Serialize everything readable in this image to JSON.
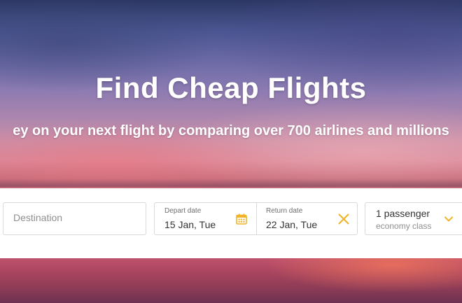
{
  "hero": {
    "title": "Find Cheap Flights",
    "subtitle": "ey on your next flight by comparing over 700 airlines and millions"
  },
  "search": {
    "destination": {
      "placeholder": "Destination"
    },
    "depart": {
      "label": "Depart date",
      "value": "15 Jan, Tue",
      "icon": "calendar-icon"
    },
    "return": {
      "label": "Return date",
      "value": "22 Jan, Tue",
      "icon": "close-icon"
    },
    "passengers": {
      "count": "1 passenger",
      "class": "economy class",
      "icon": "chevron-down-icon"
    }
  },
  "colors": {
    "accent": "#f0b429",
    "field_border": "#d9d9d9",
    "text_dark": "#333333",
    "text_muted": "#8f8f8f"
  }
}
